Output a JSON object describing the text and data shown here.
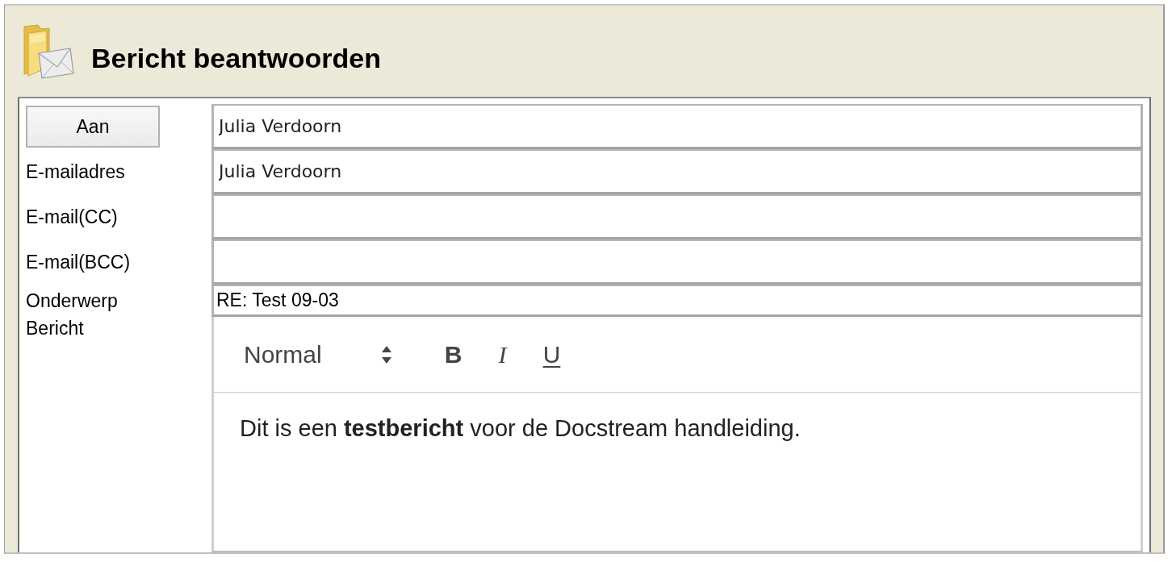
{
  "window": {
    "title": "Bericht beantwoorden"
  },
  "form": {
    "fields": [
      {
        "kind": "button",
        "label": "Aan",
        "value": "Julia Verdoorn"
      },
      {
        "kind": "address",
        "label": "E-mailadres",
        "value": "Julia Verdoorn"
      },
      {
        "kind": "address",
        "label": "E-mail(CC)"
      },
      {
        "kind": "address",
        "label": "E-mail(BCC)"
      },
      {
        "kind": "subject",
        "label": "Onderwerp",
        "value": "RE: Test 09-03"
      }
    ],
    "message": {
      "label": "Bericht",
      "toolbar": {
        "format": "Normal",
        "buttons": [
          {
            "kind": "bold",
            "label": "B"
          },
          {
            "kind": "italic",
            "label": "I"
          },
          {
            "kind": "underline",
            "label": "U"
          }
        ]
      },
      "body": "Dit is een **testbericht** voor de Docstream handleiding."
    }
  }
}
